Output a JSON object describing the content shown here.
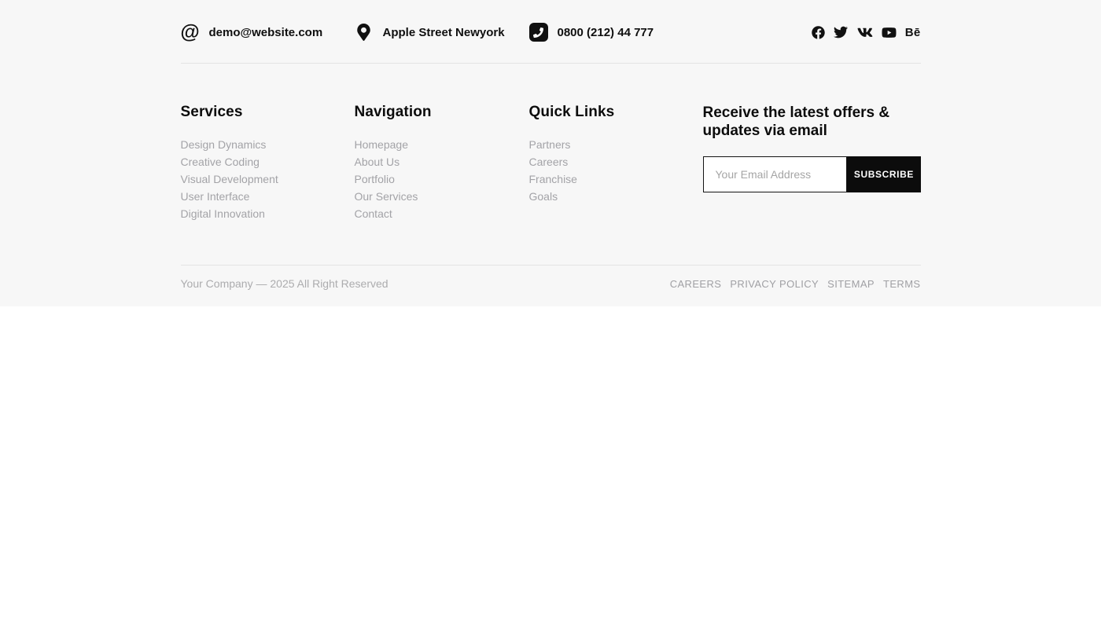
{
  "topbar": {
    "contacts": [
      {
        "icon": "at-icon",
        "text": "demo@website.com"
      },
      {
        "icon": "location-pin-icon",
        "text": "Apple Street Newyork"
      },
      {
        "icon": "phone-icon",
        "text": "0800 (212) 44 777"
      }
    ],
    "socials": [
      {
        "name": "facebook"
      },
      {
        "name": "twitter"
      },
      {
        "name": "vk"
      },
      {
        "name": "youtube"
      },
      {
        "name": "behance",
        "glyph": "Bē"
      }
    ]
  },
  "columns": [
    {
      "title": "Services",
      "links": [
        "Design Dynamics",
        "Creative Coding",
        "Visual Development",
        "User Interface",
        "Digital Innovation"
      ]
    },
    {
      "title": "Navigation",
      "links": [
        "Homepage",
        "About Us",
        "Portfolio",
        "Our Services",
        "Contact"
      ]
    },
    {
      "title": "Quick Links",
      "links": [
        "Partners",
        "Careers",
        "Franchise",
        "Goals"
      ]
    }
  ],
  "newsletter": {
    "title": "Receive the latest offers & updates via email",
    "placeholder": "Your Email Address",
    "button_label": "SUBSCRIBE",
    "input_value": ""
  },
  "bottombar": {
    "copyright": "Your Company — 2025 All Right Reserved",
    "links": [
      "CAREERS",
      "PRIVACY POLICY",
      "SITEMAP",
      "TERMS"
    ]
  },
  "colors": {
    "footer_bg": "#f7f7f7",
    "text_dark": "#0c0c0c",
    "text_muted": "#a3a3a7",
    "divider": "#e3e3e4",
    "button_bg": "#0c0c0c",
    "button_text": "#ffffff"
  }
}
